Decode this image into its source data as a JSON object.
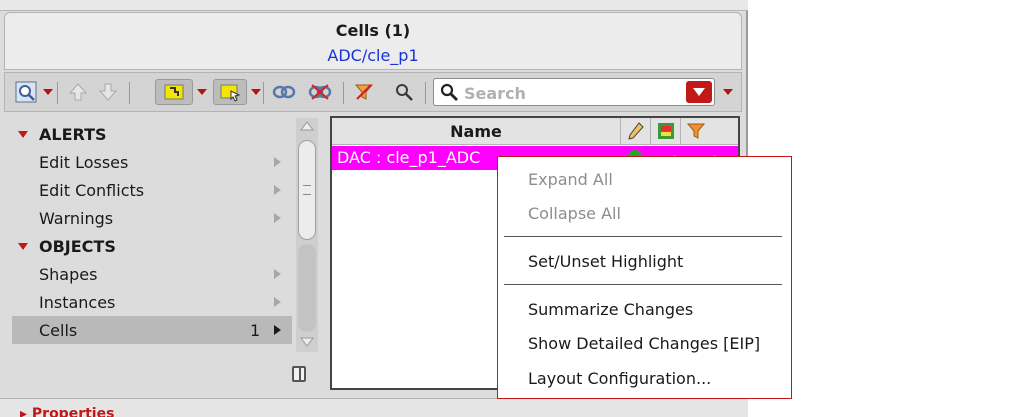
{
  "header": {
    "title": "Cells (1)",
    "path": "ADC/cle_p1"
  },
  "toolbar": {
    "search_placeholder": "Search",
    "icons": [
      "zoom-fit-icon",
      "up-arrow-icon",
      "down-arrow-icon",
      "select-mode-icon",
      "select-box-icon",
      "link-icon",
      "unlink-icon",
      "filter-icon",
      "find-icon",
      "search-icon",
      "dropdown-icon"
    ]
  },
  "tree": {
    "items": [
      {
        "label": "ALERTS",
        "type": "group"
      },
      {
        "label": "Edit Losses",
        "type": "item"
      },
      {
        "label": "Edit Conflicts",
        "type": "item"
      },
      {
        "label": "Warnings",
        "type": "item"
      },
      {
        "label": "OBJECTS",
        "type": "group"
      },
      {
        "label": "Shapes",
        "type": "item"
      },
      {
        "label": "Instances",
        "type": "item"
      },
      {
        "label": "Cells",
        "type": "item",
        "count": "1",
        "selected": true
      }
    ]
  },
  "table": {
    "columns": [
      "Name"
    ],
    "header_icons": [
      "pencil-icon",
      "layer-icon",
      "filter-icon"
    ],
    "rows": [
      {
        "name": "DAC : cle_p1_ADC"
      }
    ]
  },
  "context_menu": {
    "items": [
      {
        "label": "Expand All",
        "enabled": false
      },
      {
        "label": "Collapse All",
        "enabled": false
      },
      {
        "label": "Set/Unset Highlight",
        "enabled": true
      },
      {
        "label": "Summarize Changes",
        "enabled": true
      },
      {
        "label": "Show Detailed Changes [EIP]",
        "enabled": true
      },
      {
        "label": "Layout Configuration...",
        "enabled": true
      }
    ]
  },
  "colors": {
    "accent_red": "#c21818",
    "path_blue": "#1a33d9",
    "highlight_magenta": "#ff00ff"
  }
}
